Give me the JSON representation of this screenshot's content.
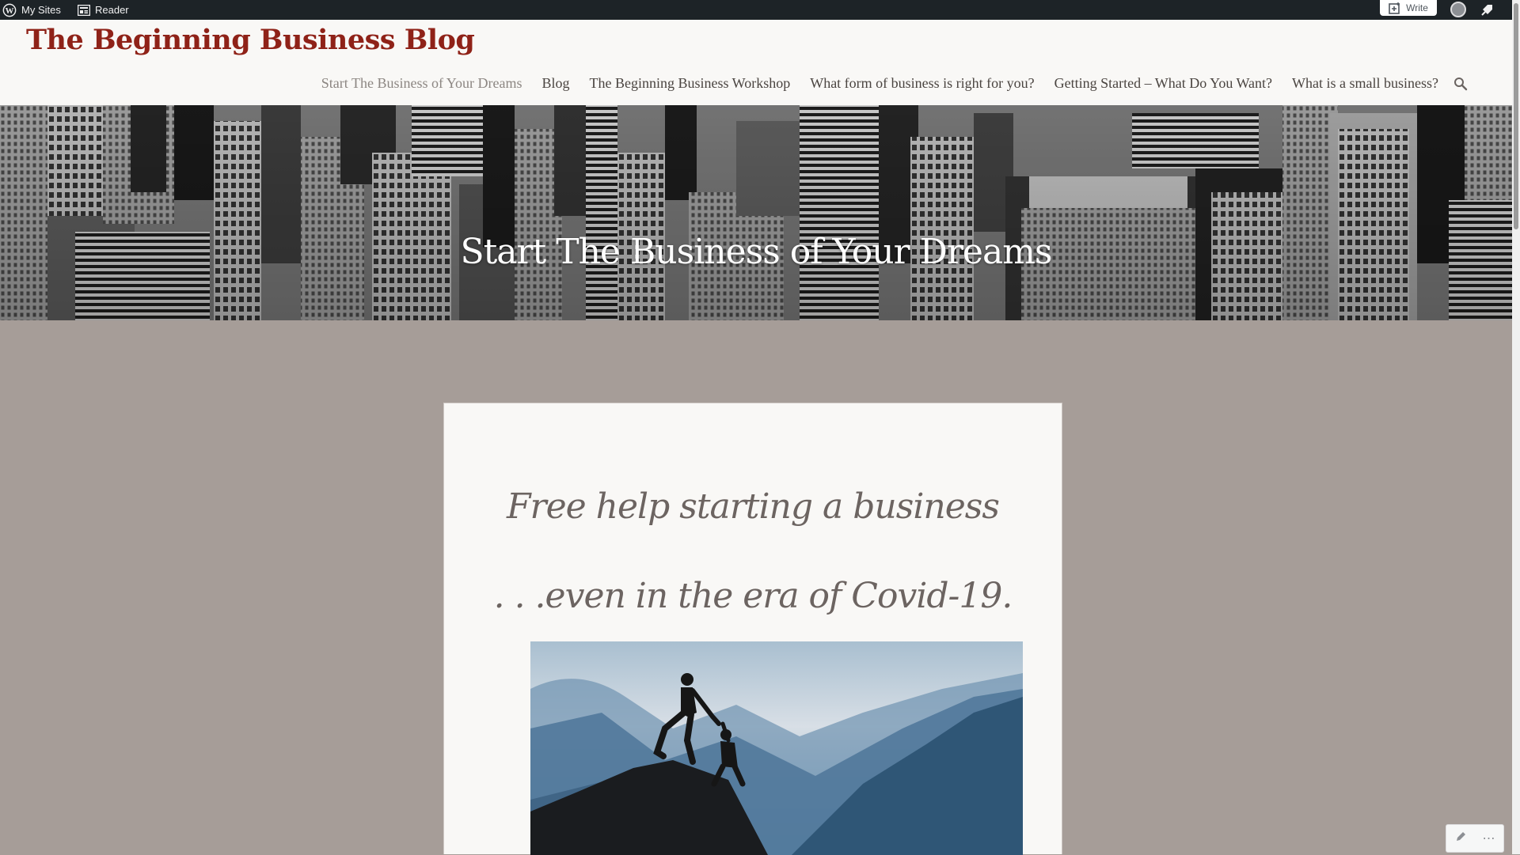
{
  "admin_bar": {
    "my_sites": "My Sites",
    "reader": "Reader",
    "write": "Write"
  },
  "site": {
    "title": "The Beginning Business Blog"
  },
  "nav": {
    "items": [
      "Start The Business of Your Dreams",
      "Blog",
      "The Beginning Business Workshop",
      "What form of business is right for you?",
      "Getting Started – What Do You Want?",
      "What is a small business?"
    ]
  },
  "hero": {
    "title": "Start The Business of Your Dreams"
  },
  "content": {
    "line1": "Free help starting a business",
    "line2": ". . .even in the era of Covid-19."
  },
  "colors": {
    "admin_bar": "#1d2327",
    "title_red": "#8f2218",
    "page_bg": "#a69d98",
    "card_bg": "#f9f8f6"
  },
  "floating_actions": {
    "more": "⋯"
  }
}
